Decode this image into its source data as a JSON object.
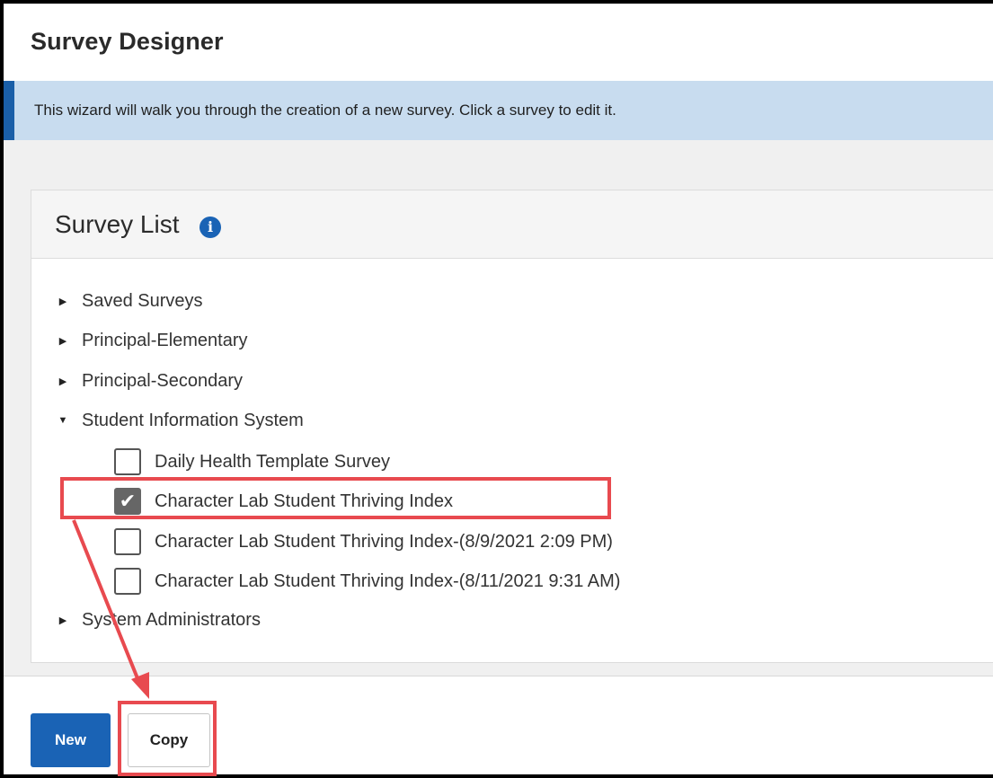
{
  "header": {
    "title": "Survey Designer"
  },
  "banner": {
    "text": "This wizard will walk you through the creation of a new survey. Click a survey to edit it."
  },
  "survey_list": {
    "title": "Survey List",
    "info_icon": "info-icon",
    "groups": [
      {
        "label": "Saved Surveys",
        "expanded": false
      },
      {
        "label": "Principal-Elementary",
        "expanded": false
      },
      {
        "label": "Principal-Secondary",
        "expanded": false
      },
      {
        "label": "Student Information System",
        "expanded": true
      },
      {
        "label": "System Administrators",
        "expanded": false
      }
    ],
    "surveys": [
      {
        "label": "Daily Health Template Survey",
        "checked": false
      },
      {
        "label": "Character Lab Student Thriving Index",
        "checked": true
      },
      {
        "label": "Character Lab Student Thriving Index-(8/9/2021 2:09 PM)",
        "checked": false
      },
      {
        "label": "Character Lab Student Thriving Index-(8/11/2021 9:31 AM)",
        "checked": false
      }
    ]
  },
  "footer": {
    "new_label": "New",
    "copy_label": "Copy"
  },
  "colors": {
    "primary": "#1a63b5",
    "banner_bg": "#c8dcef",
    "highlight": "#e84a4f"
  }
}
